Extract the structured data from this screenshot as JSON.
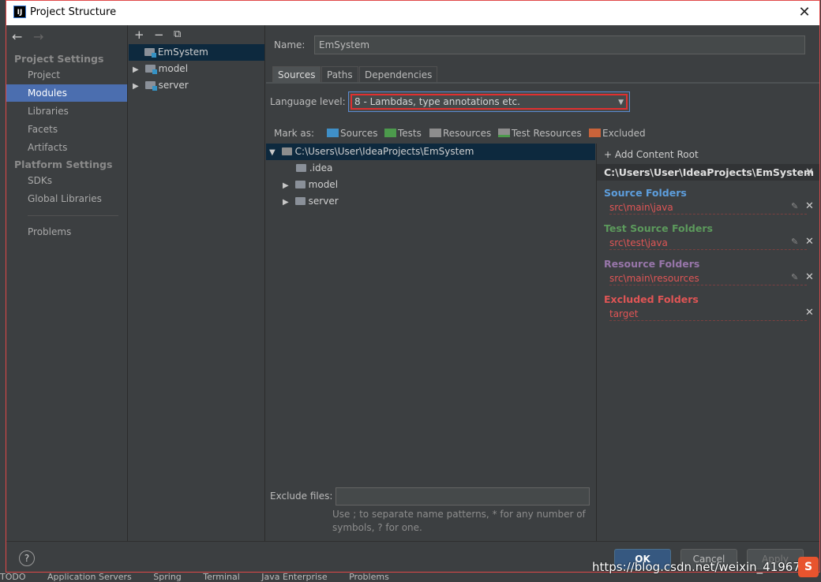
{
  "window": {
    "title": "Project Structure",
    "app_icon": "IJ"
  },
  "nav": {
    "back": "←",
    "forward": "→",
    "project_settings_header": "Project Settings",
    "platform_settings_header": "Platform Settings",
    "items": [
      "Project",
      "Modules",
      "Libraries",
      "Facets",
      "Artifacts"
    ],
    "platform_items": [
      "SDKs",
      "Global Libraries"
    ],
    "problems": "Problems",
    "selected": "Modules"
  },
  "modules": {
    "toolbar": {
      "add": "+",
      "remove": "−",
      "copy": "⧉"
    },
    "items": [
      {
        "name": "EmSystem",
        "selected": true
      },
      {
        "name": "model"
      },
      {
        "name": "server"
      }
    ]
  },
  "main": {
    "name_label": "Name:",
    "name_value": "EmSystem",
    "tabs": [
      "Sources",
      "Paths",
      "Dependencies"
    ],
    "active_tab": "Sources",
    "language_label": "Language level:",
    "language_value": "8 - Lambdas, type annotations etc.",
    "mark_as_label": "Mark as:",
    "mark_as": [
      {
        "label": "Sources",
        "color": "#3f8fc7"
      },
      {
        "label": "Tests",
        "color": "#4c9a4c"
      },
      {
        "label": "Resources",
        "color": "#8d8d8d"
      },
      {
        "label": "Test Resources",
        "color": "#8d8d8d"
      },
      {
        "label": "Excluded",
        "color": "#c9633a"
      }
    ],
    "tree": {
      "root": "C:\\Users\\User\\IdeaProjects\\EmSystem",
      "children": [
        ".idea",
        "model",
        "server"
      ]
    },
    "exclude_label": "Exclude files:",
    "exclude_value": "",
    "exclude_hint": "Use ; to separate name patterns, * for any number of symbols, ? for one."
  },
  "content_root": {
    "add_label": "+ Add Content Root",
    "path": "C:\\Users\\User\\IdeaProjects\\EmSystem",
    "source_header": "Source Folders",
    "source_path": "src\\main\\java",
    "test_header": "Test Source Folders",
    "test_path": "src\\test\\java",
    "resource_header": "Resource Folders",
    "resource_path": "src\\main\\resources",
    "excluded_header": "Excluded Folders",
    "excluded_path": "target",
    "colors": {
      "source": "#5d9edd",
      "test": "#5c9a5c",
      "resource": "#9876aa",
      "excluded": "#e05555",
      "path": "#e05555"
    }
  },
  "footer": {
    "help": "?",
    "ok": "OK",
    "cancel": "Cancel",
    "apply": "Apply"
  },
  "ide_bottom": [
    "TODO",
    "Application Servers",
    "Spring",
    "Terminal",
    "Java Enterprise",
    "Problems"
  ],
  "watermark": "https://blog.csdn.net/weixin_4196770",
  "watermark_logo": "S"
}
